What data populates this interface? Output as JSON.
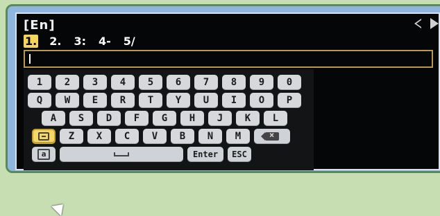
{
  "header": {
    "language": "[En]",
    "nav_left": "◁",
    "nav_right": "▶"
  },
  "candidates": [
    "1.",
    "2.",
    "3:",
    "4-",
    "5/"
  ],
  "selected_candidate_index": 0,
  "input": {
    "value": "",
    "placeholder": ""
  },
  "keyboard": {
    "row1": [
      "1",
      "2",
      "3",
      "4",
      "5",
      "6",
      "7",
      "8",
      "9",
      "0"
    ],
    "row2": [
      "Q",
      "W",
      "E",
      "R",
      "T",
      "Y",
      "U",
      "I",
      "O",
      "P"
    ],
    "row3": [
      "A",
      "S",
      "D",
      "F",
      "G",
      "H",
      "J",
      "K",
      "L"
    ],
    "row4": [
      "Z",
      "X",
      "C",
      "V",
      "B",
      "N",
      "M"
    ],
    "row5": {
      "case_label": "a",
      "space_symbol": "⎵",
      "enter_label": "Enter",
      "esc_label": "ESC"
    }
  },
  "icons": {
    "language_toggle": "keyboard-toggle-icon",
    "backspace": "backspace-icon",
    "case": "case-icon",
    "nav_left": "triangle-left-icon",
    "nav_right": "triangle-right-icon",
    "pointer": "mouse-pointer-icon"
  },
  "colors": {
    "outer_frame_bg": "#8fb6df",
    "outer_border": "#5b8a5a",
    "screen_bg": "#050607",
    "key_bg": "#d6d8dc",
    "highlight": "#f5d767",
    "input_border": "#b89a4a"
  }
}
